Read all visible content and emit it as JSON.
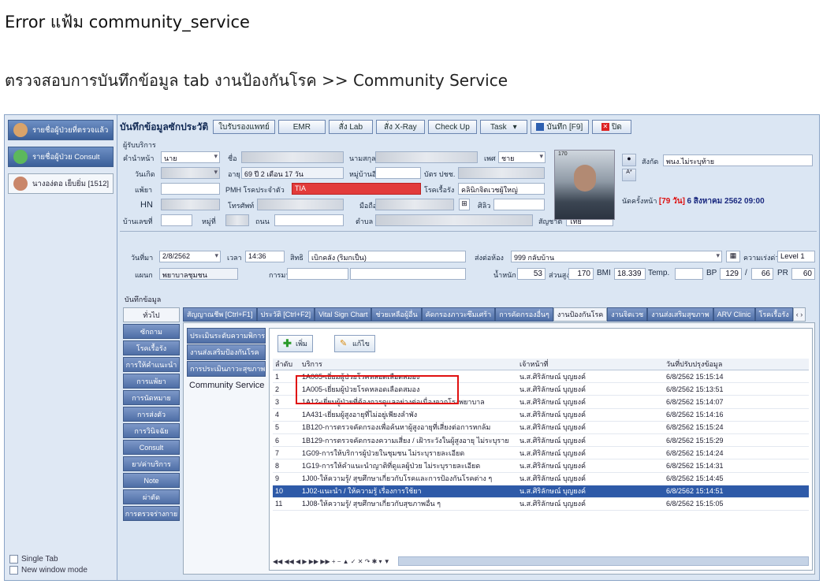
{
  "doc": {
    "title": "Error แฟ้ม community_service",
    "subtitle": "ตรวจสอบการบันทึกข้อมูล tab งานป้องกันโรค >> Community Service"
  },
  "sidebar": {
    "items": [
      {
        "label": "รายชื่อผู้ป่วยที่ตรวจแล้ว"
      },
      {
        "label": "รายชื่อผู้ป่วย Consult"
      },
      {
        "label": "นางอง่ดอ เย็บยิ่ม [1512]"
      }
    ],
    "single_tab": "Single Tab",
    "new_window": "New window mode"
  },
  "toolbar": {
    "title": "บันทึกข้อมูลซักประวัติ",
    "buttons": [
      "ใบรับรองแพทย์",
      "EMR",
      "สั่ง Lab",
      "สั่ง X-Ray",
      "Check Up",
      "Task",
      "บันทึก [F9]",
      "ปิด"
    ]
  },
  "patient": {
    "section": "ผู้รับบริการ",
    "prefix_label": "คำนำหน้า",
    "prefix": "นาย",
    "fname_label": "ชื่อ",
    "lname_label": "นามสกุล",
    "sex_label": "เพศ",
    "sex": "ชาย",
    "dob_label": "วันเกิด",
    "dob_suffix": "3",
    "age_label": "อายุ",
    "age": "69 ปี 2 เดือน 17 วัน",
    "village_label": "หมู่บ้านอีก",
    "cid_label": "บัตร ปชช.",
    "allergy_label": "แพ้ยา",
    "pmh_label": "PMH โรคประจำตัว",
    "pmh": "TIA",
    "clinic_label": "โรคเรื้อรัง",
    "clinic": "คลินิกจิตเวชผู้ใหญ่",
    "hn_label": "HN",
    "phone_label": "โทรศัพท์",
    "mobile_label": "มือถือ",
    "religion_label": "ศิลิว",
    "house_label": "บ้านเลขที่",
    "moo_label": "หมู่ที่",
    "road_label": "ถนน",
    "tambon_label": "ตำบล",
    "nation_label": "สัญชาติ",
    "nation": "ไทย",
    "photo_num": "170",
    "right_label": "สังกัด",
    "right": "พนง.ไม่ระบุท้าย",
    "next_appt_label": "นัดครั้งหน้า",
    "next_days": "[79 วัน]",
    "next_date": "6 สิงหาคม 2562 09:00"
  },
  "visit": {
    "date_label": "วันที่มา",
    "date": "2/8/2562",
    "time_label": "เวลา",
    "time": "14:36",
    "right_label": "สิทธิ",
    "right": "เบิกคลัง (ริมกเป็น)",
    "room_label": "ส่งต่อห้อง",
    "room": "999 กลับบ้าน",
    "urgency_label": "ความเร่งด่วน",
    "urgency": "Level 1",
    "dept_label": "แผนก",
    "dept": "พยาบาลชุมชน",
    "cc_label": "การมา",
    "weight_label": "น้ำหนัก",
    "weight": "53",
    "height_label": "ส่วนสูง",
    "height": "170",
    "bmi_label": "BMI",
    "bmi": "18.339",
    "temp_label": "Temp.",
    "bp_label": "BP",
    "bp_sys": "129",
    "bp_dia": "66",
    "pr_label": "PR",
    "pr": "60"
  },
  "record": {
    "label": "บันทึกข้อมูล",
    "vtabs": [
      "ทั่วไป",
      "ซักถาม",
      "โรคเรื้อรัง",
      "การให้คำแนะนำ",
      "การแพ้ยา",
      "การนัดหมาย",
      "การส่งตัว",
      "การวินิจฉัย",
      "Consult",
      "ยา/ค่าบริการ",
      "Note",
      "ผ่าตัด",
      "การตรวจร่างกาย"
    ],
    "htabs": [
      "สัญญาณชีพ [Ctrl+F1]",
      "ประวัติ [Ctrl+F2]",
      "Vital Sign Chart",
      "ช่วยเหลือผู้อื่น",
      "คัดกรองภาวะซึมเศร้า",
      "การคัดกรองอื่นๆ",
      "งานป้องกันโรค",
      "งานจิตเวช",
      "งานส่งเสริมสุขภาพ",
      "ARV Clinic",
      "โรคเรื้อรัง"
    ],
    "ltabs": [
      "ประเมินระดับความพิการ",
      "งานส่งเสริมป้องกันโรค",
      "การประเมินภาวะสุขภาพ",
      "Community Service"
    ],
    "add_label": "เพิ่ม",
    "edit_label": "แก้ไข",
    "columns": [
      "ลำดับ",
      "บริการ",
      "เจ้าหน้าที่",
      "วันที่ปรับปรุงข้อมูล"
    ],
    "rows": [
      {
        "no": "1",
        "service": "1A005-เยี่ยมผู้ป่วยโรคหลอดเลือดสมอง",
        "staff": "น.ส.ศิริลักษณ์ บุญยงค์",
        "updated": "6/8/2562 15:15:14"
      },
      {
        "no": "2",
        "service": "1A005-เยี่ยมผู้ป่วยโรคหลอดเลือดสมอง",
        "staff": "น.ส.ศิริลักษณ์ บุญยงค์",
        "updated": "6/8/2562 15:13:51"
      },
      {
        "no": "3",
        "service": "1A12-เยี่ยมผู้ป่วยที่ต้องการดูแลอย่างต่อเนื่องจากโรงพยาบาล",
        "staff": "น.ส.ศิริลักษณ์ บุญยงค์",
        "updated": "6/8/2562 15:14:07"
      },
      {
        "no": "4",
        "service": "1A431-เยี่ยมผู้สูงอายุที่ไม่อยู่เพียงลำพัง",
        "staff": "น.ส.ศิริลักษณ์ บุญยงค์",
        "updated": "6/8/2562 15:14:16"
      },
      {
        "no": "5",
        "service": "1B120-การตรวจคัดกรองเพื่อค้นหาผู้สูงอายุที่เสี่ยงต่อการหกล้ม",
        "staff": "น.ส.ศิริลักษณ์ บุญยงค์",
        "updated": "6/8/2562 15:15:24"
      },
      {
        "no": "6",
        "service": "1B129-การตรวจคัดกรองความเสี่ยง / เฝ้าระวังในผู้สูงอายุ ไม่ระบุราย",
        "staff": "น.ส.ศิริลักษณ์ บุญยงค์",
        "updated": "6/8/2562 15:15:29"
      },
      {
        "no": "7",
        "service": "1G09-การให้บริการผู้ป่วยในชุมชน ไม่ระบุรายละเอียด",
        "staff": "น.ส.ศิริลักษณ์ บุญยงค์",
        "updated": "6/8/2562 15:14:24"
      },
      {
        "no": "8",
        "service": "1G19-การให้คำแนะนำญาติที่ดูแลผู้ป่วย ไม่ระบุรายละเอียด",
        "staff": "น.ส.ศิริลักษณ์ บุญยงค์",
        "updated": "6/8/2562 15:14:31"
      },
      {
        "no": "9",
        "service": "1J00-ให้ความรู้/ สุขศึกษาเกี่ยวกับโรคและการป้องกันโรคต่าง ๆ",
        "staff": "น.ส.ศิริลักษณ์ บุญยงค์",
        "updated": "6/8/2562 15:14:45"
      },
      {
        "no": "10",
        "service": "1J02-แนะนำ / ให้ความรู้ เรื่องการใช้ยา",
        "staff": "น.ส.ศิริลักษณ์ บุญยงค์",
        "updated": "6/8/2562 15:14:51"
      },
      {
        "no": "11",
        "service": "1J08-ให้ความรู้/ สุขศึกษาเกี่ยวกับสุขภาพอื่น ๆ",
        "staff": "น.ส.ศิริลักษณ์ บุญยงค์",
        "updated": "6/8/2562 15:15:05"
      }
    ],
    "nav": "◀◀ ◀◀ ◀ ▶ ▶▶ ▶▶ + − ▲ ✓ ✕ ↷ ✱ ▾ ▼"
  }
}
